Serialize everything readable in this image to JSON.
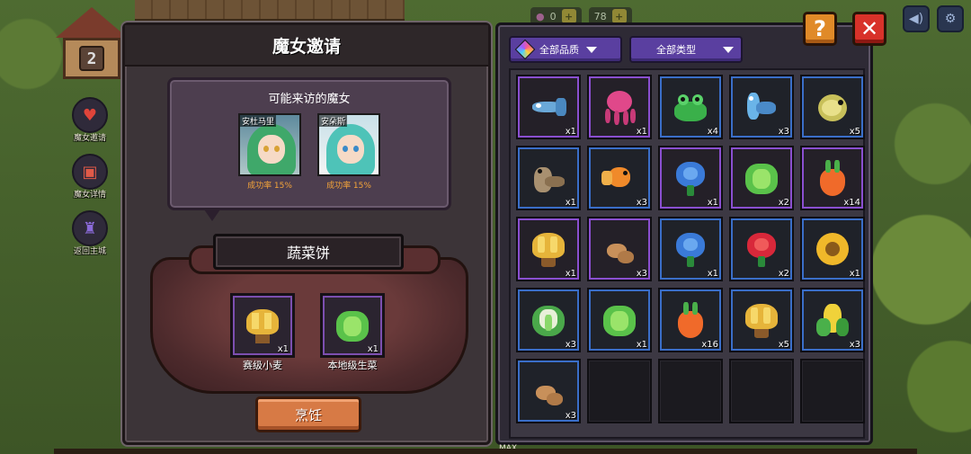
{
  "background": {
    "house_number": "2",
    "hud_value_1": "0",
    "hud_value_2": "78",
    "max_label": "MAX"
  },
  "side_nav": [
    {
      "label": "魔女邀请",
      "icon": "heart-icon"
    },
    {
      "label": "魔女详情",
      "icon": "gift-icon"
    },
    {
      "label": "返回主城",
      "icon": "castle-icon"
    }
  ],
  "top_buttons": {
    "help": "?",
    "close": "✕"
  },
  "left_panel": {
    "title": "魔女邀请",
    "visitors_title": "可能来访的魔女",
    "witches": [
      {
        "name": "安杜马里",
        "rate": "成功率 15%",
        "hair": "#3fa86a",
        "eye": "#d8a235"
      },
      {
        "name": "安朵斯",
        "rate": "成功率 15%",
        "hair": "#4ec3b8",
        "eye": "#3a8ac8"
      }
    ],
    "dish": "蔬菜饼",
    "ingredients": [
      {
        "name": "赛级小麦",
        "count": "x1",
        "item": "wheat"
      },
      {
        "name": "本地级生菜",
        "count": "x1",
        "item": "lettuce"
      }
    ],
    "cook_button": "烹饪"
  },
  "right_panel": {
    "filter_quality": "全部品质",
    "filter_type": "全部类型",
    "items": [
      {
        "icon": "fish-icon",
        "count": "x1",
        "quality": "purple"
      },
      {
        "icon": "octopus-icon",
        "count": "x1",
        "quality": "purple"
      },
      {
        "icon": "frog-icon",
        "count": "x4",
        "quality": "blue"
      },
      {
        "icon": "blue-fish-icon",
        "count": "x3",
        "quality": "blue"
      },
      {
        "icon": "pufferfish-icon",
        "count": "x5",
        "quality": "blue"
      },
      {
        "icon": "catfish-icon",
        "count": "x1",
        "quality": "blue"
      },
      {
        "icon": "goldfish-icon",
        "count": "x3",
        "quality": "blue"
      },
      {
        "icon": "blue-rose-icon",
        "count": "x1",
        "quality": "purple"
      },
      {
        "icon": "lettuce-icon",
        "count": "x2",
        "quality": "purple"
      },
      {
        "icon": "carrot-icon",
        "count": "x14",
        "quality": "purple"
      },
      {
        "icon": "wheat-icon",
        "count": "x1",
        "quality": "purple"
      },
      {
        "icon": "potato-icon",
        "count": "x3",
        "quality": "purple"
      },
      {
        "icon": "blue-rose-icon",
        "count": "x1",
        "quality": "blue"
      },
      {
        "icon": "red-rose-icon",
        "count": "x2",
        "quality": "blue"
      },
      {
        "icon": "sunflower-icon",
        "count": "x1",
        "quality": "blue"
      },
      {
        "icon": "cabbage-icon",
        "count": "x3",
        "quality": "blue"
      },
      {
        "icon": "lettuce-icon",
        "count": "x1",
        "quality": "blue"
      },
      {
        "icon": "carrot-icon",
        "count": "x16",
        "quality": "blue"
      },
      {
        "icon": "wheat-icon",
        "count": "x5",
        "quality": "blue"
      },
      {
        "icon": "corn-icon",
        "count": "x3",
        "quality": "blue"
      },
      {
        "icon": "potato-icon",
        "count": "x3",
        "quality": "blue"
      },
      {
        "icon": "",
        "count": "",
        "quality": "empty"
      },
      {
        "icon": "",
        "count": "",
        "quality": "empty"
      },
      {
        "icon": "",
        "count": "",
        "quality": "empty"
      },
      {
        "icon": "",
        "count": "",
        "quality": "empty"
      }
    ]
  }
}
